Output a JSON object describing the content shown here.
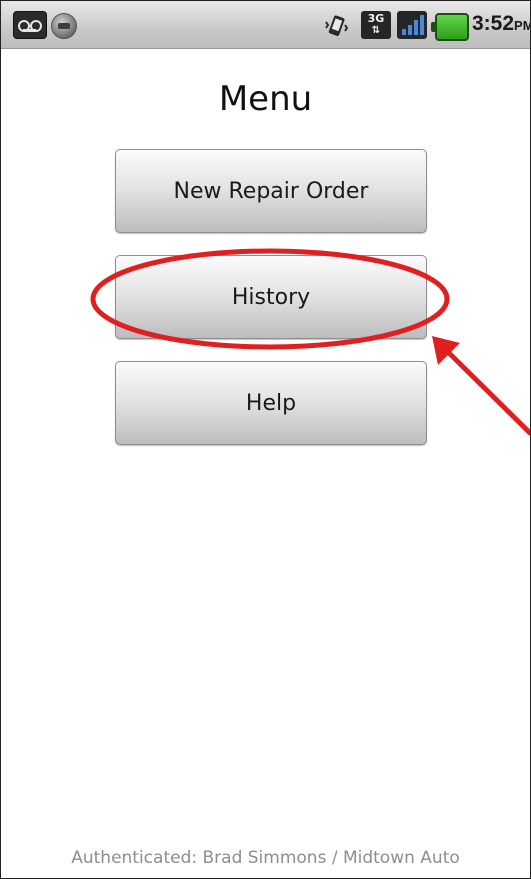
{
  "status_bar": {
    "network": "3G",
    "time": "3:52",
    "ampm": "PM",
    "icons": [
      "voicemail-icon",
      "sync-icon",
      "vibrate-icon",
      "3g-icon",
      "signal-icon",
      "battery-icon"
    ]
  },
  "title": "Menu",
  "buttons": [
    {
      "label": "New Repair Order"
    },
    {
      "label": "History"
    },
    {
      "label": "Help"
    }
  ],
  "footer": "Authenticated: Brad Simmons / Midtown Auto",
  "colors": {
    "annotation": "#e02020",
    "button_text": "#1a1a1a",
    "footer_text": "#8e8e8e"
  }
}
